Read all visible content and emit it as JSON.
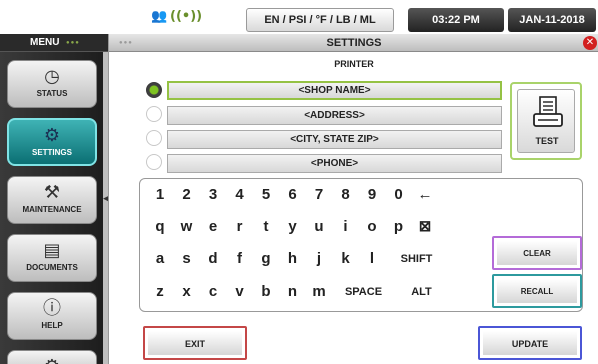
{
  "status_bar": {
    "units": "EN / PSI / °F / LB / ML",
    "time": "03:22 PM",
    "date": "JAN-11-2018",
    "icons": [
      "bluetooth-icon",
      "wifi-icon"
    ]
  },
  "sidebar": {
    "title": "MENU",
    "items": [
      {
        "label": "STATUS",
        "icon": "gauge-icon"
      },
      {
        "label": "SETTINGS",
        "icon": "gear-icon",
        "active": true
      },
      {
        "label": "MAINTENANCE",
        "icon": "tools-icon"
      },
      {
        "label": "DOCUMENTS",
        "icon": "document-icon"
      },
      {
        "label": "HELP",
        "icon": "help-icon"
      },
      {
        "label": "",
        "icon": "gear-icon"
      }
    ]
  },
  "panel": {
    "title": "SETTINGS",
    "subtitle": "PRINTER",
    "fields": [
      {
        "value": "<SHOP NAME>",
        "selected": true
      },
      {
        "value": "<ADDRESS>",
        "selected": false
      },
      {
        "value": "<CITY, STATE ZIP>",
        "selected": false
      },
      {
        "value": "<PHONE>",
        "selected": false
      }
    ],
    "test_label": "TEST",
    "keyboard": {
      "rows": [
        [
          "1",
          "2",
          "3",
          "4",
          "5",
          "6",
          "7",
          "8",
          "9",
          "0",
          "←"
        ],
        [
          "q",
          "w",
          "e",
          "r",
          "t",
          "y",
          "u",
          "i",
          "o",
          "p",
          "⊠"
        ],
        [
          "a",
          "s",
          "d",
          "f",
          "g",
          "h",
          "j",
          "k",
          "l",
          "SHIFT"
        ],
        [
          "z",
          "x",
          "c",
          "v",
          "b",
          "n",
          "m",
          "SPACE",
          "ALT"
        ]
      ]
    },
    "clear_label": "CLEAR",
    "recall_label": "RECALL",
    "exit_label": "EXIT",
    "update_label": "UPDATE"
  }
}
